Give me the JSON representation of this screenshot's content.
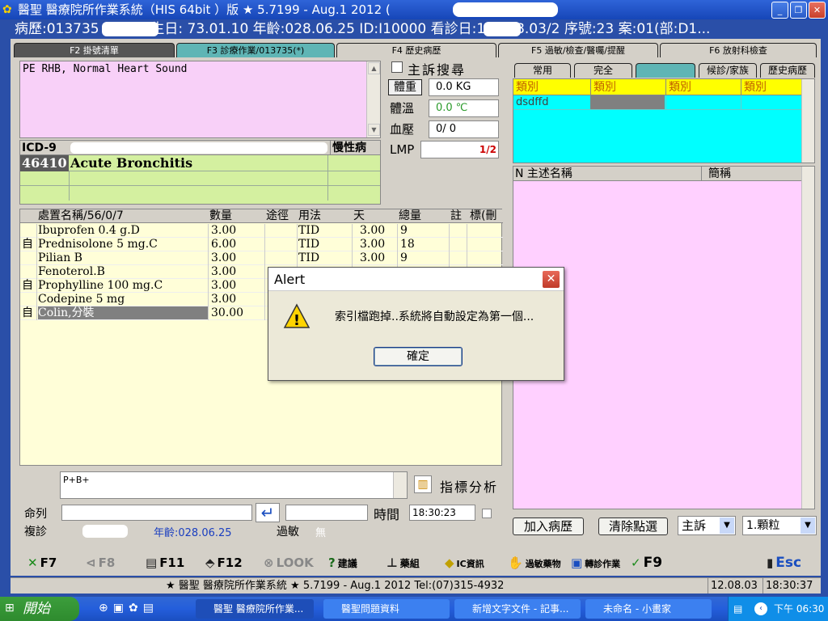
{
  "window": {
    "title": "醫聖 醫療院所作業系統（HIS 64bit ）版 ★ 5.7199 - Aug.1 2012 (",
    "minimize": "_",
    "maximize": "❐",
    "close": "✕"
  },
  "patient_bar": "病歷:013735 (男/　) 生日: 73.01.10 年齡:028.06.25 ID:I10000 看診日:101.08.03/2 序號:23 案:01(部:D1...",
  "tabs": [
    {
      "label": "F2 掛號清單"
    },
    {
      "label": "F3 診療作業/013735(*)"
    },
    {
      "label": "F4 歷史病歷"
    },
    {
      "label": "F5 過敏/檢查/醫囑/提醒"
    },
    {
      "label": "F6 放射科檢查"
    }
  ],
  "complaint": {
    "text": "PE RHB, Normal Heart Sound",
    "search_label": "主訴搜尋"
  },
  "vitals": {
    "weight_label": "體重",
    "weight": "0.0 KG",
    "temp_label": "體溫",
    "temp": "0.0 ℃",
    "bp_label": "血壓",
    "bp": "0/ 0",
    "lmp_label": "LMP",
    "lmp": "1/2"
  },
  "icd": {
    "header_code": "ICD-9",
    "header_chronic": "慢性病",
    "row": {
      "code": "46410",
      "name": "Acute Bronchitis"
    }
  },
  "rx": {
    "headers": {
      "name": "處置名稱/56/0/7",
      "qty": "數量",
      "route": "途徑",
      "usage": "用法",
      "days": "天",
      "total": "總量",
      "note": "註",
      "flag": "標(刪"
    },
    "rows": [
      {
        "self": "",
        "name": "Ibuprofen 0.4 g.D",
        "qty": "3.00",
        "usage": "TID",
        "days": "3.00",
        "total": "9"
      },
      {
        "self": "自",
        "name": "Prednisolone 5 mg.C",
        "qty": "6.00",
        "usage": "TID",
        "days": "3.00",
        "total": "18"
      },
      {
        "self": "",
        "name": "Pilian B",
        "qty": "3.00",
        "usage": "TID",
        "days": "3.00",
        "total": "9"
      },
      {
        "self": "",
        "name": "Fenoterol.B",
        "qty": "3.00",
        "usage": "",
        "days": "",
        "total": ""
      },
      {
        "self": "自",
        "name": "Prophylline 100 mg.C",
        "qty": "3.00",
        "usage": "",
        "days": "",
        "total": ""
      },
      {
        "self": "",
        "name": "Codepine 5 mg",
        "qty": "3.00",
        "usage": "",
        "days": "",
        "total": ""
      },
      {
        "self": "自",
        "name": "Colin,分裝",
        "qty": "30.00",
        "usage": "",
        "days": "",
        "total": ""
      }
    ]
  },
  "notes": {
    "text": "P+B+",
    "analysis_label": "指標分析"
  },
  "command": {
    "label": "命列",
    "time_label": "時間",
    "time": "18:30:23"
  },
  "revisit": {
    "label": "複診",
    "age": "年齡:028.06.25",
    "allergy_label": "過敏",
    "allergy_value": "無"
  },
  "right_tabs": [
    {
      "label": "常用"
    },
    {
      "label": "完全"
    },
    {
      "label": ""
    },
    {
      "label": "候診/家族"
    },
    {
      "label": "歷史病歷"
    }
  ],
  "category": {
    "headers": [
      "類別",
      "類別",
      "類別",
      "類別"
    ],
    "row": [
      "dsdffd",
      "",
      "",
      ""
    ]
  },
  "complaint_list": {
    "col1": "N 主述名稱",
    "col2": "簡稱"
  },
  "right_buttons": {
    "add_history": "加入病歷",
    "clear": "清除點選",
    "complaint_select": "主訴",
    "unit_select": "1.顆粒"
  },
  "toolbar": [
    {
      "key": "F7",
      "icon": "✕"
    },
    {
      "key": "F8",
      "icon": "⊲"
    },
    {
      "key": "F11",
      "icon": "▤"
    },
    {
      "key": "F12",
      "icon": "⬘"
    },
    {
      "key": "LOOK",
      "icon": "⊗"
    },
    {
      "key": "建議",
      "icon": "?"
    },
    {
      "key": "藥組",
      "icon": "⊥"
    },
    {
      "key": "IC資訊",
      "icon": "◆"
    },
    {
      "key": "過敏藥物",
      "icon": "✋"
    },
    {
      "key": "轉診作業",
      "icon": "▣"
    },
    {
      "key": "F9",
      "icon": "✓"
    },
    {
      "key": "Esc",
      "icon": "▮"
    }
  ],
  "status": {
    "text": "★ 醫聖 醫療院所作業系統 ★ 5.7199 - Aug.1 2012 Tel:(07)315-4932",
    "date": "12.08.03",
    "time": "18:30:37"
  },
  "taskbar": {
    "start": "開始",
    "tasks": [
      "醫聖 醫療院所作業...",
      "醫聖問題資料",
      "新增文字文件 - 記事...",
      "未命名 - 小畫家"
    ],
    "clock": "下午 06:30"
  },
  "dialog": {
    "title": "Alert",
    "message": "索引檔跑掉..系統將自動設定為第一個...",
    "ok": "確定"
  }
}
